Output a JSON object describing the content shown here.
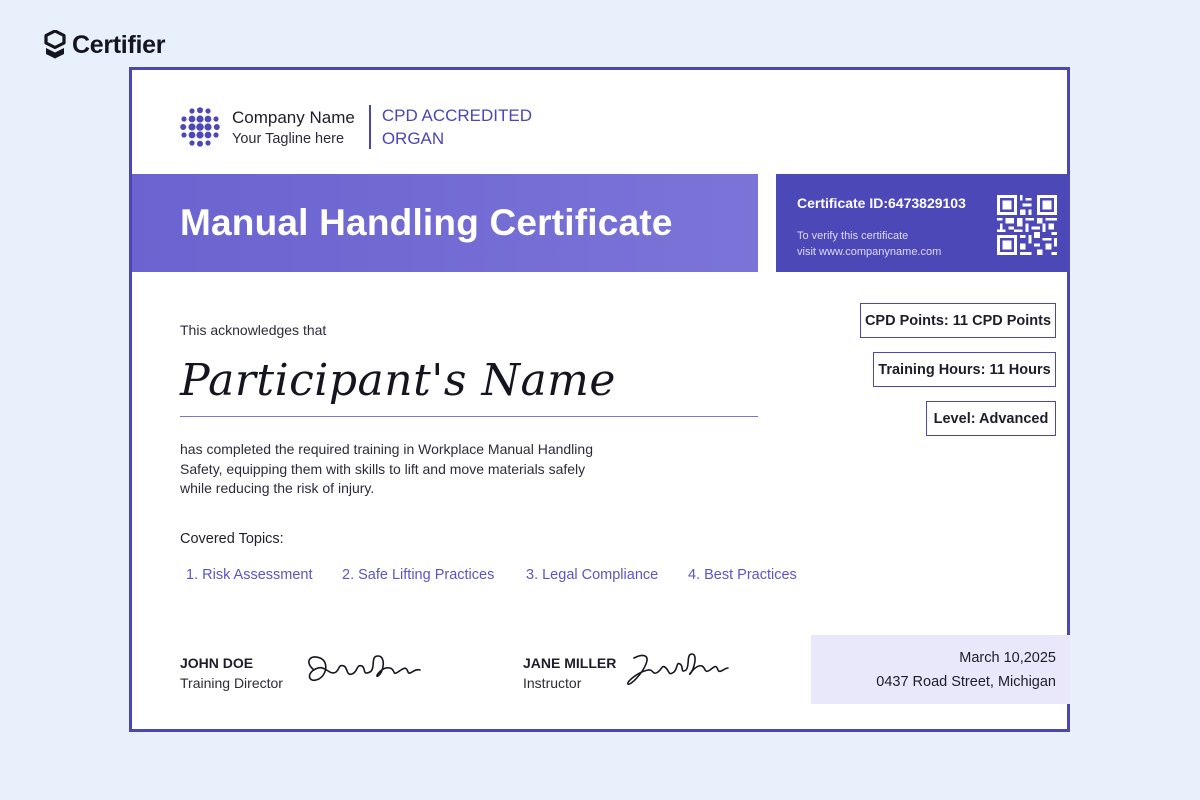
{
  "brand": {
    "name": "Certifier",
    "icon": "certifier-logo-icon"
  },
  "company": {
    "logo_icon": "dotted-circle-logo-icon",
    "name": "Company Name",
    "tagline": "Your Tagline here",
    "accreditation": "CPD ACCREDITED ORGAN"
  },
  "certificate": {
    "title": "Manual Handling Certificate",
    "id_label": "Certificate ID:6473829103",
    "verify_line1": "To verify this certificate",
    "verify_line2": "visit www.companyname.com",
    "qr_icon": "qr-code-icon"
  },
  "badges": {
    "cpd_points": "CPD Points: 11 CPD Points",
    "training_hours": "Training Hours: 11 Hours",
    "level": "Level: Advanced"
  },
  "body": {
    "acknowledges": "This acknowledges that",
    "participant_name": "Participant's Name",
    "description": "has completed the required training in Workplace Manual Handling Safety, equipping them with skills to lift and move materials safely while reducing the risk of injury."
  },
  "topics": {
    "label": "Covered Topics:",
    "items": [
      "1. Risk Assessment",
      "2. Safe Lifting Practices",
      "3. Legal Compliance",
      "4. Best Practices"
    ]
  },
  "signatures": [
    {
      "name": "JOHN DOE",
      "role": "Training Director"
    },
    {
      "name": "JANE MILLER",
      "role": "Instructor"
    }
  ],
  "footer": {
    "date": "March 10,2025",
    "address": "0437 Road Street, Michigan"
  },
  "colors": {
    "page_background": "#e8f0fb",
    "accent": "#4a47b5",
    "title_band": "#6b63cf",
    "id_band": "#4d48b8",
    "topic_text": "#5b55c6",
    "footer_box": "#e9e7fa"
  }
}
